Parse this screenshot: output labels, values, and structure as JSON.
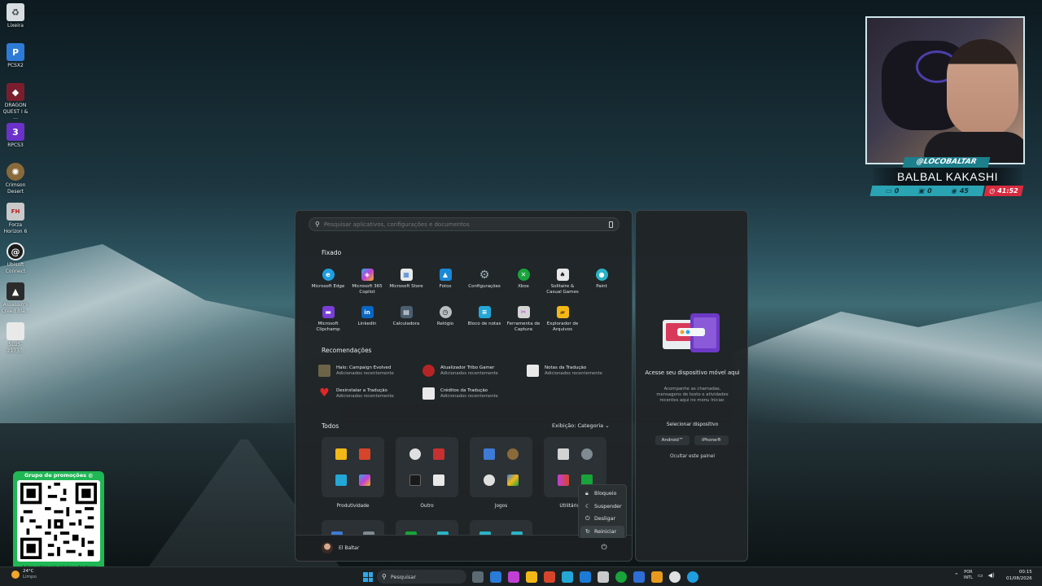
{
  "desktop_icons": [
    {
      "label": "Lixeira",
      "icon": "recycle-bin-icon",
      "color": "#d7dde0"
    },
    {
      "label": "PCSX2",
      "icon": "pcsx2-icon",
      "color": "#2d7bd6"
    },
    {
      "label": "DRAGON QUEST I & ...",
      "icon": "dragon-quest-icon",
      "color": "#7a1e2e"
    },
    {
      "label": "RPCS3",
      "icon": "rpcs3-icon",
      "color": "#6a32c8"
    },
    {
      "label": "Crimson Desert",
      "icon": "crimson-desert-icon",
      "color": "#8a6a3a"
    },
    {
      "label": "Forza Horizon 6",
      "icon": "forza-icon",
      "color": "#c9c9c9"
    },
    {
      "label": "Ubisoft Connect",
      "icon": "ubisoft-icon",
      "color": "#1a1a1a"
    },
    {
      "label": "Assassin's Creed Bla...",
      "icon": "assassins-creed-icon",
      "color": "#2b2b2b"
    },
    {
      "label": "SLUS-2173...",
      "icon": "file-icon",
      "color": "#e9e9e9"
    }
  ],
  "stream_overlay": {
    "handle": "@LOCOBALTAR",
    "name": "BALBAL KAKASHI",
    "stats": [
      "0",
      "0",
      "45"
    ],
    "timer": "41:52"
  },
  "promo": {
    "title": "Grupo de promoções",
    "url": "rbstore.net/group/zu/whatsapp/hardware"
  },
  "start_menu": {
    "search_placeholder": "Pesquisar aplicativos, configurações e documentos",
    "pinned_title": "Fixado",
    "pinned": [
      {
        "label": "Microsoft Edge",
        "icon": "edge-icon",
        "color": "#1f9ee0"
      },
      {
        "label": "Microsoft 365 Copilot",
        "icon": "copilot-icon",
        "color": "#c23fd6"
      },
      {
        "label": "Microsoft Store",
        "icon": "store-icon",
        "color": "#3d7bd6"
      },
      {
        "label": "Fotos",
        "icon": "photos-icon",
        "color": "#1a88d6"
      },
      {
        "label": "Configurações",
        "icon": "settings-icon",
        "color": "#7f8a92"
      },
      {
        "label": "Xbox",
        "icon": "xbox-icon",
        "color": "#18a43a"
      },
      {
        "label": "Solitaire & Casual Games",
        "icon": "solitaire-icon",
        "color": "#e8e8e8"
      },
      {
        "label": "Paint",
        "icon": "paint-icon",
        "color": "#2ab3c6"
      },
      {
        "label": "Microsoft Clipchamp",
        "icon": "clipchamp-icon",
        "color": "#7a3ed6"
      },
      {
        "label": "LinkedIn",
        "icon": "linkedin-icon",
        "color": "#0a66c2"
      },
      {
        "label": "Calculadora",
        "icon": "calculator-icon",
        "color": "#4b5f70"
      },
      {
        "label": "Relógio",
        "icon": "clock-icon",
        "color": "#b8bec2"
      },
      {
        "label": "Bloco de notas",
        "icon": "notepad-icon",
        "color": "#23a7d6"
      },
      {
        "label": "Ferramenta de Captura",
        "icon": "snipping-tool-icon",
        "color": "#d3d3d3"
      },
      {
        "label": "Explorador de Arquivos",
        "icon": "file-explorer-icon",
        "color": "#f2b817"
      }
    ],
    "recommended_title": "Recomendações",
    "recommended": [
      {
        "name": "Halo: Campaign Evolved",
        "sub": "Adicionados recentemente",
        "color": "#6b6448"
      },
      {
        "name": "Atualizador Tribo Gamer",
        "sub": "Adicionados recentemente",
        "color": "#b52525"
      },
      {
        "name": "Notas da Tradução",
        "sub": "Adicionados recentemente",
        "color": "#e9e9e9"
      },
      {
        "name": "Desinstalar a Tradução",
        "sub": "Adicionados recentemente",
        "color": "#e32626"
      },
      {
        "name": "Créditos da Tradução",
        "sub": "Adicionados recentemente",
        "color": "#e9e9e9"
      }
    ],
    "all_title": "Todos",
    "view_label": "Exibição: Categoria",
    "categories": [
      {
        "label": "Produtividade",
        "colors": [
          "#f2b817",
          "#d6452a",
          "#23a7d6",
          "#c23fd6"
        ]
      },
      {
        "label": "Outro",
        "colors": [
          "#e0e0e0",
          "#c73030",
          "#1a1a1a",
          "#e8e8e8"
        ]
      },
      {
        "label": "Jogos",
        "colors": [
          "#3d7bd6",
          "#8a6a3a",
          "#e0e0e0",
          "#18a43a"
        ]
      },
      {
        "label": "Utilitários e F",
        "colors": [
          "#d3d3d3",
          "#7f8a92",
          "#c23fd6",
          "#18a43a"
        ]
      }
    ],
    "second_row_colors": [
      [
        "#3d7bd6",
        "#7f8a92"
      ],
      [
        "#18a43a",
        "#2ab3c6"
      ],
      [
        "#2ab3c6",
        "#2ab3c6"
      ],
      []
    ],
    "user_name": "El Baltar",
    "power_menu": [
      {
        "label": "Bloqueio",
        "icon": "lock-icon"
      },
      {
        "label": "Suspender",
        "icon": "sleep-icon"
      },
      {
        "label": "Desligar",
        "icon": "shutdown-icon"
      },
      {
        "label": "Reiniciar",
        "icon": "restart-icon"
      }
    ]
  },
  "side_panel": {
    "title": "Acesse seu dispositivo móvel aqui",
    "description": "Acompanhe as chamadas, mensagens de texto e atividades recentes aqui no menu Iniciar.",
    "select_label": "Selecionar dispositivo",
    "android_label": "Android™",
    "iphone_label": "iPhone®",
    "hide_label": "Ocultar este painel"
  },
  "taskbar": {
    "weather_temp": "24°C",
    "weather_status": "Limpo",
    "search_label": "Pesquisar",
    "apps": [
      "#5b6a73",
      "#2a7bd6",
      "#c23fd6",
      "#f2b817",
      "#d6452a",
      "#23a7d6",
      "#1b7bd6",
      "#c9c9c9",
      "#18a43a",
      "#2d6fd6",
      "#e69b1c",
      "#e0e0e0",
      "#1f9ee0"
    ],
    "lang_top": "POR",
    "lang_bottom": "INTL",
    "time": "00:15",
    "date": "01/08/2026"
  }
}
